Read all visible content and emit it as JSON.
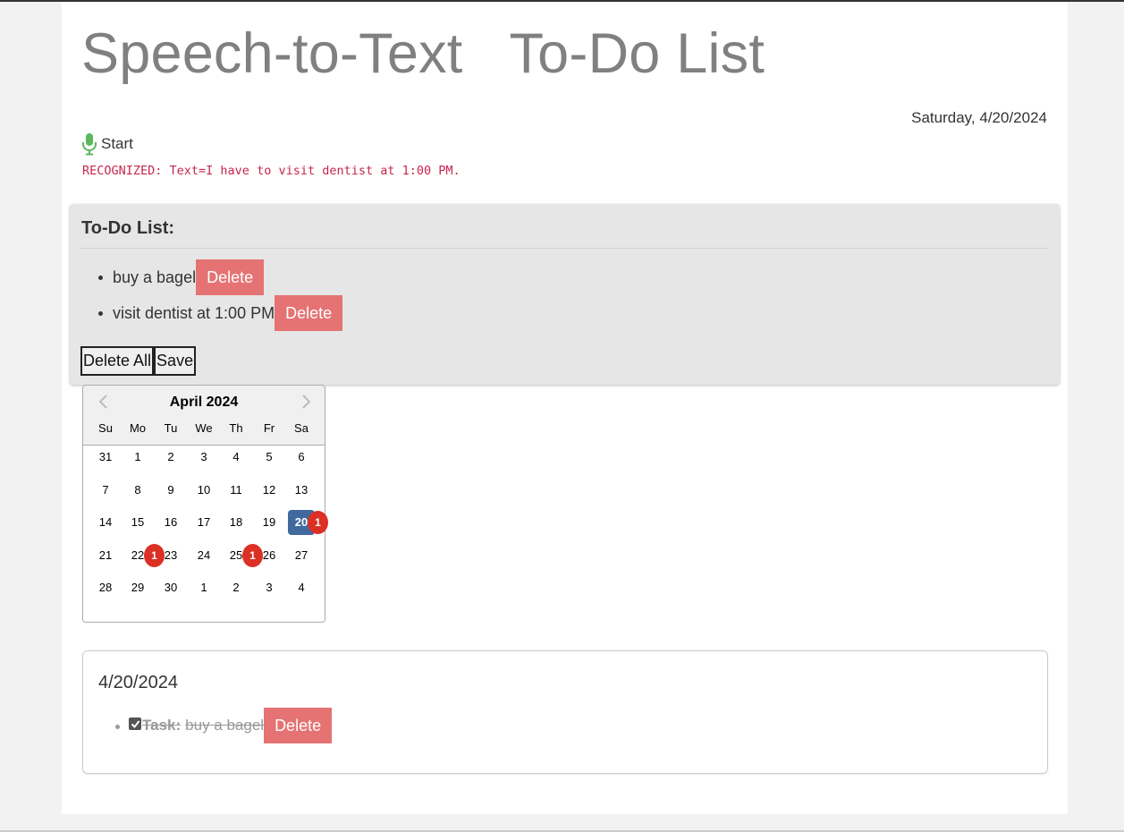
{
  "header": {
    "title": "Speech-to-Text   To-Do List",
    "date": "Saturday, 4/20/2024"
  },
  "speech": {
    "start_label": "Start",
    "mic_icon": "microphone-icon",
    "mic_color": "#5cb85c",
    "recognized": "RECOGNIZED: Text=I have to visit dentist at 1:00 PM."
  },
  "todo": {
    "heading": "To-Do List:",
    "items": [
      {
        "text": "buy a bagel",
        "delete_label": "Delete"
      },
      {
        "text": "visit dentist at 1:00 PM",
        "delete_label": "Delete"
      }
    ],
    "delete_all_label": "Delete All",
    "save_label": "Save"
  },
  "calendar": {
    "month_label": "April 2024",
    "prev_icon": "chevron-left-icon",
    "next_icon": "chevron-right-icon",
    "weekdays": [
      "Su",
      "Mo",
      "Tu",
      "We",
      "Th",
      "Fr",
      "Sa"
    ],
    "weeks": [
      [
        "31",
        "1",
        "2",
        "3",
        "4",
        "5",
        "6"
      ],
      [
        "7",
        "8",
        "9",
        "10",
        "11",
        "12",
        "13"
      ],
      [
        "14",
        "15",
        "16",
        "17",
        "18",
        "19",
        "20"
      ],
      [
        "21",
        "22",
        "23",
        "24",
        "25",
        "26",
        "27"
      ],
      [
        "28",
        "29",
        "30",
        "1",
        "2",
        "3",
        "4"
      ]
    ],
    "selected_day": "20",
    "badges": [
      {
        "after_day": "20",
        "count": "1"
      },
      {
        "after_day": "22",
        "count": "1"
      },
      {
        "after_day": "25",
        "count": "1"
      }
    ],
    "selected_color": "#41699e",
    "badge_color": "#dc3025"
  },
  "day_card": {
    "date": "4/20/2024",
    "tasks": [
      {
        "label": "Task:",
        "text": "buy a bagel",
        "done": true,
        "delete_label": "Delete"
      }
    ]
  },
  "colors": {
    "delete_button": "#e57373",
    "title": "#808080",
    "recognized_text": "#c7254e",
    "panel_bg": "#e6e6e6"
  }
}
